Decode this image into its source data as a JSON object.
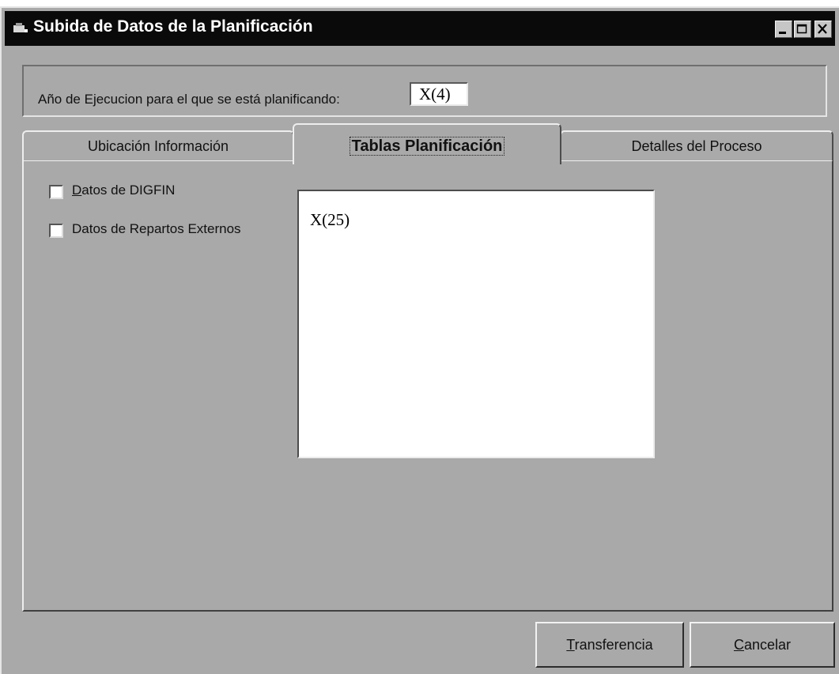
{
  "window": {
    "title": "Subida de Datos de la Planificación",
    "controls": [
      "minimize-icon",
      "maximize-icon",
      "close-icon"
    ]
  },
  "year": {
    "label": "Año de Ejecucion para el que se está planificando:",
    "value": "X(4)"
  },
  "tabs": [
    {
      "label": "Ubicación Información",
      "active": false
    },
    {
      "label": "Tablas Planificación",
      "active": true
    },
    {
      "label": "Detalles del Proceso",
      "active": false
    }
  ],
  "checkboxes": [
    {
      "accel": "D",
      "rest": "atos de DIGFIN",
      "checked": false
    },
    {
      "accel": "",
      "rest": "Datos de Repartos Externos",
      "checked": false
    }
  ],
  "list": {
    "value": "X(25)"
  },
  "buttons": {
    "transfer": {
      "accel": "T",
      "rest": "ransferencia"
    },
    "cancel": {
      "accel": "C",
      "rest": "ancelar"
    }
  },
  "colors": {
    "face": "#a9a9a9",
    "titlebar": "#0a0a0a",
    "field": "#ffffff"
  }
}
